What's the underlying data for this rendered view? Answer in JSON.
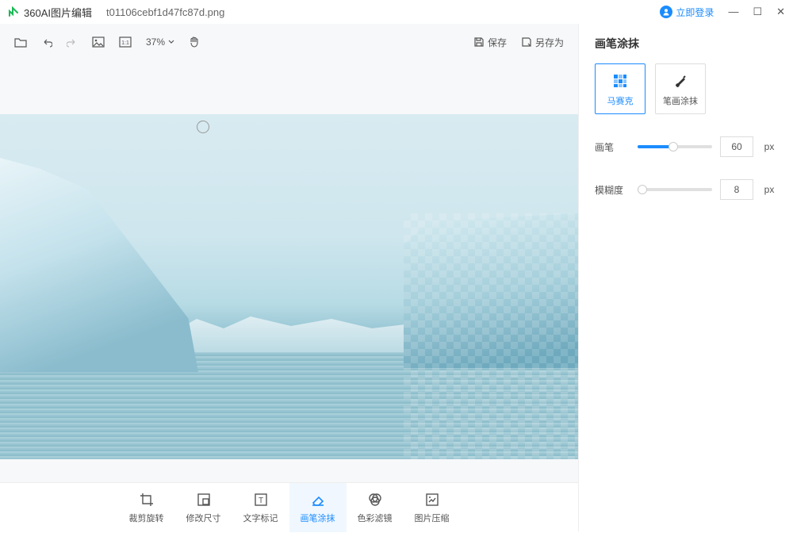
{
  "titlebar": {
    "app_name": "360AI图片编辑",
    "file_name": "t01106cebf1d47fc87d.png",
    "login_label": "立即登录"
  },
  "toolbar": {
    "zoom": "37%",
    "save_label": "保存",
    "save_as_label": "另存为"
  },
  "panel": {
    "title": "画笔涂抹",
    "option_mosaic": "马赛克",
    "option_brush": "笔画涂抹",
    "brush_label": "画笔",
    "brush_value": "60",
    "brush_unit": "px",
    "blur_label": "模糊度",
    "blur_value": "8",
    "blur_unit": "px"
  },
  "footer": {
    "crop": "裁剪旋转",
    "resize": "修改尺寸",
    "text": "文字标记",
    "brush": "画笔涂抹",
    "filter": "色彩滤镜",
    "compress": "图片压缩"
  }
}
